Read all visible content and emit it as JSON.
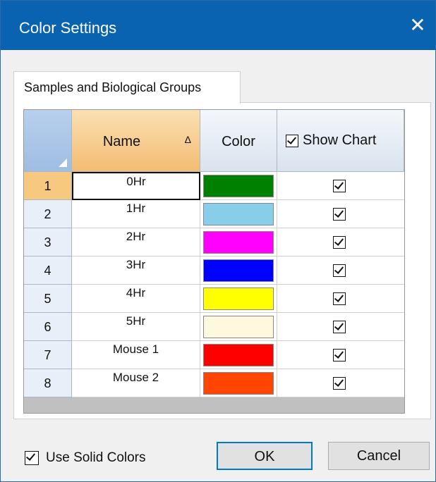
{
  "window": {
    "title": "Color Settings",
    "close_glyph": "✕"
  },
  "tab": {
    "label": "Samples and Biological Groups"
  },
  "grid": {
    "columns": {
      "name": "Name",
      "sort_glyph": "Δ",
      "color": "Color",
      "show_chart": "Show Chart",
      "show_chart_checked": true
    },
    "rows": [
      {
        "num": "1",
        "name": "0Hr",
        "color": "#008000",
        "checked": true
      },
      {
        "num": "2",
        "name": "1Hr",
        "color": "#87CEEB",
        "checked": true
      },
      {
        "num": "3",
        "name": "2Hr",
        "color": "#FF00FF",
        "checked": true
      },
      {
        "num": "4",
        "name": "3Hr",
        "color": "#0000FF",
        "checked": true
      },
      {
        "num": "5",
        "name": "4Hr",
        "color": "#FFFF00",
        "checked": true
      },
      {
        "num": "6",
        "name": "5Hr",
        "color": "#FFF8DC",
        "checked": true
      },
      {
        "num": "7",
        "name": "Mouse 1",
        "color": "#FF0000",
        "checked": true
      },
      {
        "num": "8",
        "name": "Mouse 2",
        "color": "#FF4500",
        "checked": true
      }
    ]
  },
  "footer": {
    "use_solid_colors": "Use Solid Colors",
    "use_solid_checked": true,
    "ok": "OK",
    "cancel": "Cancel"
  }
}
